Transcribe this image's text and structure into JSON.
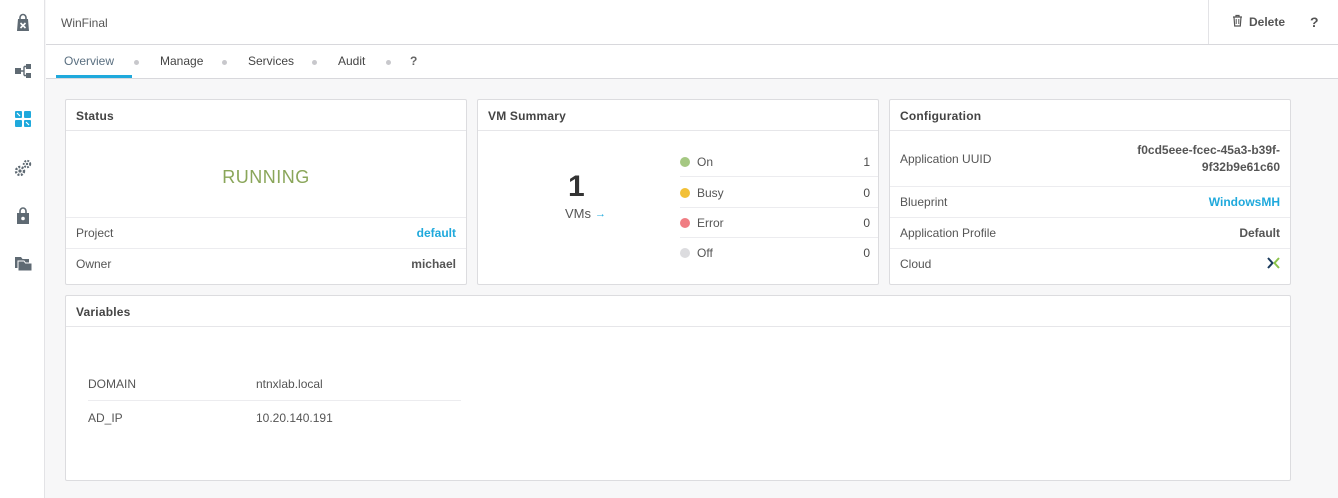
{
  "header": {
    "title": "WinFinal",
    "delete_label": "Delete",
    "help_label": "?"
  },
  "tabs": [
    {
      "label": "Overview",
      "active": true
    },
    {
      "label": "Manage",
      "active": false
    },
    {
      "label": "Services",
      "active": false
    },
    {
      "label": "Audit",
      "active": false
    },
    {
      "label": "?",
      "active": false
    }
  ],
  "sidebar": {
    "icons": [
      "blueprint-bag-icon",
      "topology-icon",
      "apps-grid-icon",
      "gears-icon",
      "marketplace-lock-icon",
      "folders-icon"
    ]
  },
  "status_card": {
    "title": "Status",
    "state": "RUNNING",
    "rows": [
      {
        "key": "Project",
        "value": "default",
        "link": true
      },
      {
        "key": "Owner",
        "value": "michael",
        "link": false
      }
    ]
  },
  "vm_summary": {
    "title": "VM Summary",
    "count": "1",
    "count_label": "VMs",
    "statuses": [
      {
        "label": "On",
        "count": "1",
        "color": "#a5c882"
      },
      {
        "label": "Busy",
        "count": "0",
        "color": "#f2c037"
      },
      {
        "label": "Error",
        "count": "0",
        "color": "#f07d83"
      },
      {
        "label": "Off",
        "count": "0",
        "color": "#dcdcdf"
      }
    ]
  },
  "configuration": {
    "title": "Configuration",
    "uuid_key": "Application UUID",
    "uuid_line1": "f0cd5eee-fcec-45a3-b39f-",
    "uuid_line2": "9f32b9e61c60",
    "rows": [
      {
        "key": "Blueprint",
        "value": "WindowsMH",
        "link": true
      },
      {
        "key": "Application Profile",
        "value": "Default",
        "link": false
      },
      {
        "key": "Cloud",
        "value": "",
        "icon": "nutanix-x-icon"
      }
    ]
  },
  "variables": {
    "title": "Variables",
    "rows": [
      {
        "key": "DOMAIN",
        "value": "ntnxlab.local"
      },
      {
        "key": "AD_IP",
        "value": "10.20.140.191"
      }
    ]
  },
  "colors": {
    "accent": "#1fa9dc",
    "running": "#8aa65a"
  }
}
